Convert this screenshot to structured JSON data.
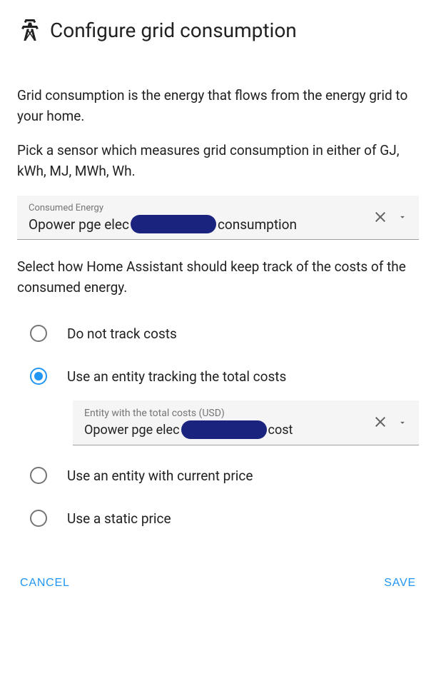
{
  "header": {
    "title": "Configure grid consumption"
  },
  "descriptions": {
    "intro": "Grid consumption is the energy that flows from the energy grid to your home.",
    "units": "Pick a sensor which measures grid consumption in either of GJ, kWh, MJ, MWh, Wh.",
    "costs": "Select how Home Assistant should keep track of the costs of the consumed energy."
  },
  "consumed_energy": {
    "label": "Consumed Energy",
    "value_prefix": "Opower pge elec",
    "value_suffix": "consumption"
  },
  "cost_options": {
    "none": "Do not track costs",
    "entity_total": "Use an entity tracking the total costs",
    "entity_current": "Use an entity with current price",
    "static": "Use a static price"
  },
  "cost_entity": {
    "label": "Entity with the total costs (USD)",
    "value_prefix": "Opower pge elec",
    "value_suffix": "cost"
  },
  "footer": {
    "cancel": "CANCEL",
    "save": "SAVE"
  }
}
